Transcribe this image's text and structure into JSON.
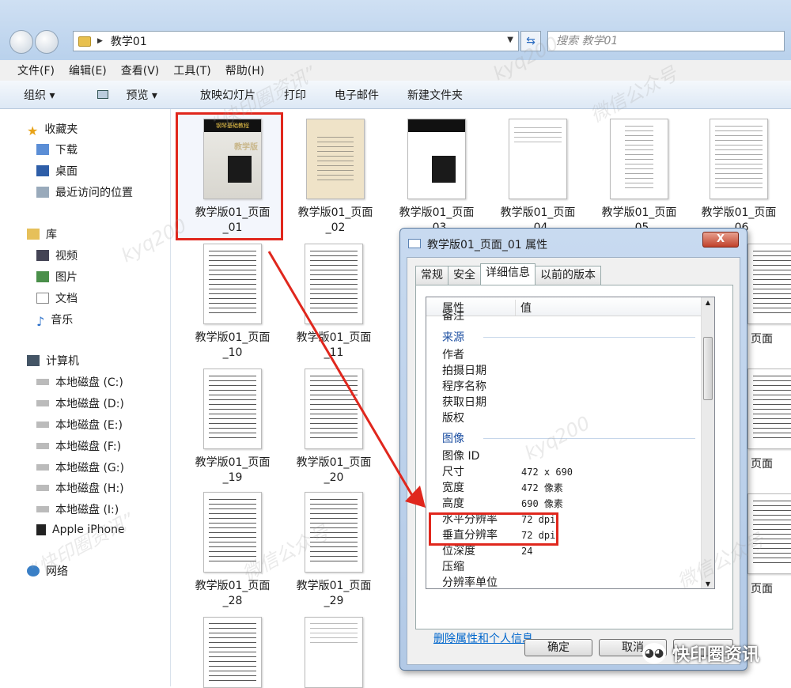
{
  "address": {
    "path": "教学01",
    "search_placeholder": "搜索 教学01"
  },
  "menu": [
    "文件(F)",
    "编辑(E)",
    "查看(V)",
    "工具(T)",
    "帮助(H)"
  ],
  "toolbar": [
    "组织 ▾",
    "预览 ▾",
    "放映幻灯片",
    "打印",
    "电子邮件",
    "新建文件夹"
  ],
  "sidebar": {
    "favorites": {
      "label": "收藏夹",
      "items": [
        "下载",
        "桌面",
        "最近访问的位置"
      ]
    },
    "library": {
      "label": "库",
      "items": [
        "视频",
        "图片",
        "文档",
        "音乐"
      ]
    },
    "computer": {
      "label": "计算机",
      "items": [
        "本地磁盘 (C:)",
        "本地磁盘 (D:)",
        "本地磁盘 (E:)",
        "本地磁盘 (F:)",
        "本地磁盘 (G:)",
        "本地磁盘 (H:)",
        "本地磁盘 (I:)",
        "Apple iPhone"
      ]
    },
    "network": "网络"
  },
  "thumbnails": {
    "row1": [
      {
        "l1": "教学版01_页面",
        "l2": "_01"
      },
      {
        "l1": "教学版01_页面",
        "l2": "_02"
      },
      {
        "l1": "教学版01_页面",
        "l2": "_03"
      },
      {
        "l1": "教学版01_页面",
        "l2": "_04"
      },
      {
        "l1": "教学版01_页面",
        "l2": "_05"
      },
      {
        "l1": "教学版01_页面",
        "l2": "_06"
      }
    ],
    "col1": [
      {
        "l1": "教学版01_页面",
        "l2": "_10"
      },
      {
        "l1": "教学版01_页面",
        "l2": "_19"
      },
      {
        "l1": "教学版01_页面",
        "l2": "_28"
      }
    ],
    "col2": [
      {
        "l1": "教学版01_页面",
        "l2": "_11"
      },
      {
        "l1": "教学版01_页面",
        "l2": "_20"
      },
      {
        "l1": "教学版01_页面",
        "l2": "_29"
      }
    ],
    "right_label": "页面",
    "cover_title": "钢琴基础教程",
    "cover_badge": "教学版"
  },
  "dialog": {
    "title": "教学版01_页面_01 属性",
    "close": "X",
    "tabs": [
      "常规",
      "安全",
      "详细信息",
      "以前的版本"
    ],
    "header": {
      "prop": "属性",
      "value": "值"
    },
    "cut_row": "备注",
    "group_source": "来源",
    "source_rows": [
      "作者",
      "拍摄日期",
      "程序名称",
      "获取日期",
      "版权"
    ],
    "group_image": "图像",
    "image_rows": [
      {
        "k": "图像 ID",
        "v": ""
      },
      {
        "k": "尺寸",
        "v": "472 x 690"
      },
      {
        "k": "宽度",
        "v": "472 像素"
      },
      {
        "k": "高度",
        "v": "690 像素"
      },
      {
        "k": "水平分辨率",
        "v": "72 dpi"
      },
      {
        "k": "垂直分辨率",
        "v": "72 dpi"
      },
      {
        "k": "位深度",
        "v": "24"
      },
      {
        "k": "压缩",
        "v": ""
      },
      {
        "k": "分辨率单位",
        "v": ""
      }
    ],
    "link": "删除属性和个人信息",
    "ok": "确定",
    "cancel": "取消"
  },
  "watermarks": [
    "kyq200",
    "“快印圈资讯”",
    "微信公众号"
  ],
  "brand": "快印圈资讯",
  "colors": {
    "highlight": "#e0271d",
    "link": "#0066cc"
  }
}
